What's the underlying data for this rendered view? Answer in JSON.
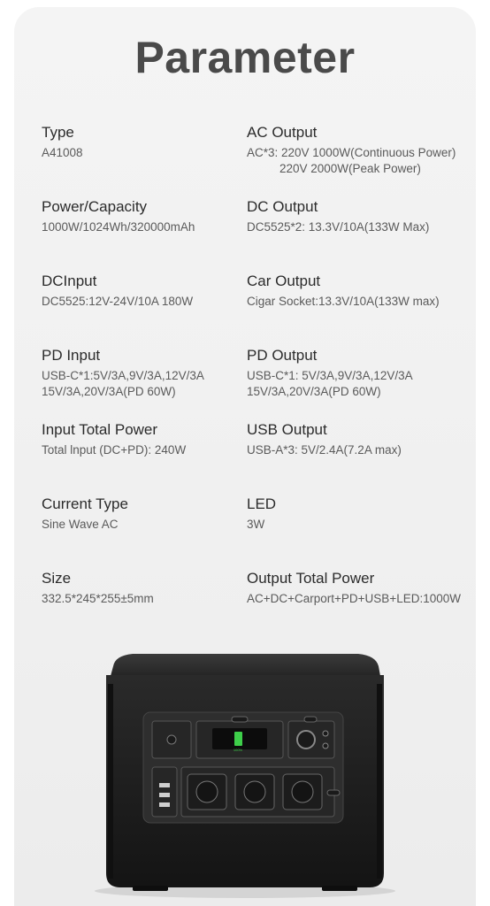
{
  "title": "Parameter",
  "left": [
    {
      "label": "Type",
      "lines": [
        "A41008"
      ]
    },
    {
      "label": "Power/Capacity",
      "lines": [
        "1000W/1024Wh/320000mAh"
      ]
    },
    {
      "label": "DCInput",
      "lines": [
        "DC5525:12V-24V/10A 180W"
      ]
    },
    {
      "label": "PD Input",
      "lines": [
        "USB-C*1:5V/3A,9V/3A,12V/3A",
        "15V/3A,20V/3A(PD 60W)"
      ]
    },
    {
      "label": "Input Total Power",
      "lines": [
        "Total lnput (DC+PD): 240W"
      ]
    },
    {
      "label": "Current Type",
      "lines": [
        "Sine Wave AC"
      ]
    },
    {
      "label": "Size",
      "lines": [
        "332.5*245*255±5mm"
      ]
    }
  ],
  "right": [
    {
      "label": "AC Output",
      "lines": [
        "AC*3: 220V 1000W(Continuous Power)",
        "220V 2000W(Peak Power)"
      ]
    },
    {
      "label": "DC Output",
      "lines": [
        "DC5525*2: 13.3V/10A(133W Max)"
      ]
    },
    {
      "label": "Car Output",
      "lines": [
        "Cigar Socket:13.3V/10A(133W max)"
      ]
    },
    {
      "label": "PD Output",
      "lines": [
        "USB-C*1: 5V/3A,9V/3A,12V/3A",
        "15V/3A,20V/3A(PD 60W)"
      ]
    },
    {
      "label": "USB Output",
      "lines": [
        "USB-A*3: 5V/2.4A(7.2A max)"
      ]
    },
    {
      "label": "LED",
      "lines": [
        "3W"
      ]
    },
    {
      "label": "Output Total Power",
      "lines": [
        "AC+DC+Carport+PD+USB+LED:1000W"
      ]
    }
  ],
  "product": {
    "name": "power-station",
    "display_text": "100%"
  },
  "colors": {
    "title": "#4a4a4a",
    "label": "#2b2b2b",
    "value": "#5a5a5a",
    "body": "#1e1e1e",
    "battery_green": "#3ecf4a"
  }
}
